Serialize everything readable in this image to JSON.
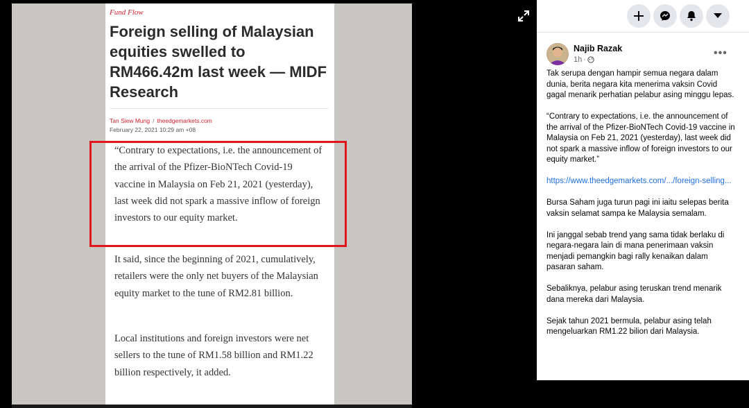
{
  "article": {
    "kicker": "Fund Flow",
    "headline": "Foreign selling of Malaysian equities swelled to RM466.42m last week — MIDF Research",
    "author": "Tan Siew Mung",
    "source": "theedgemarkets.com",
    "date": "February 22, 2021 10:29 am +08",
    "paragraphs": [
      "“Contrary to expectations, i.e. the announcement of the arrival of the Pfizer-BioNTech Covid-19 vaccine in Malaysia on Feb 21, 2021 (yesterday), last week did not spark a massive inflow of foreign investors to our equity market.",
      "It said, since the beginning of 2021, cumulatively, retailers were the only net buyers of the Malaysian equity market to the tune of RM2.81 billion.",
      "Local institutions and foreign investors were net sellers to the tune of RM1.58 billion and RM1.22 billion respectively, it added."
    ]
  },
  "colors": {
    "accent_red": "#e0161c",
    "link_blue": "#216fdb",
    "fb_grey_button": "#e4e6eb"
  },
  "icons": {
    "expand": "expand-icon",
    "create": "plus-icon",
    "messenger": "messenger-icon",
    "notifications": "bell-icon",
    "account": "caret-down-icon"
  },
  "post": {
    "author": "Najib Razak",
    "time": "1h",
    "paragraphs": [
      "Tak serupa dengan hampir semua negara dalam dunia, berita negara kita menerima vaksin Covid gagal menarik perhatian pelabur asing minggu lepas.",
      "“Contrary to expectations, i.e. the announcement of the arrival of the Pfizer-BioNTech Covid-19 vaccine in Malaysia on Feb 21, 2021 (yesterday), last week did not spark a massive inflow of foreign investors to our equity market.”",
      "Bursa Saham juga turun pagi ini iaitu selepas berita vaksin selamat sampa ke Malaysia semalam.",
      "Ini janggal sebab trend yang sama tidak berlaku di negara-negara lain di mana penerimaan vaksin menjadi pemangkin bagi rally kenaikan dalam pasaran saham.",
      "Sebaliknya, pelabur asing teruskan trend menarik dana mereka dari Malaysia.",
      "Sejak tahun 2021 bermula, pelabur asing telah mengeluarkan RM1.22 bilion dari Malaysia."
    ],
    "link": "https://www.theedgemarkets.com/.../foreign-selling..."
  }
}
